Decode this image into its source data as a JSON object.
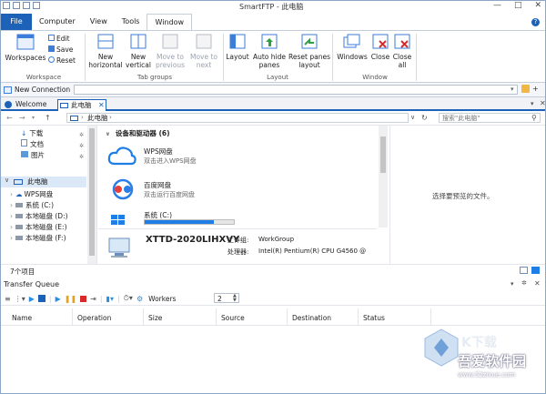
{
  "window": {
    "title": "SmartFTP - 此电脑"
  },
  "ribbon_tabs": [
    "File",
    "Computer",
    "View",
    "Tools",
    "Window"
  ],
  "ribbon": {
    "workspace": {
      "big": "Workspaces",
      "small": [
        "Edit",
        "Save",
        "Reset"
      ],
      "label": "Workspace"
    },
    "tab_groups": {
      "items": [
        "New horizontal",
        "New vertical",
        "Move to previous",
        "Move to next"
      ],
      "label": "Tab groups"
    },
    "layout": {
      "items": [
        "Layout",
        "Auto hide panes",
        "Reset panes layout"
      ],
      "label": "Layout"
    },
    "window": {
      "items": [
        "Windows",
        "Close",
        "Close all"
      ],
      "label": "Window"
    }
  },
  "connection": {
    "label": "New Connection"
  },
  "doc_tabs": [
    "Welcome",
    "此电脑"
  ],
  "explorer": {
    "address": "此电脑",
    "search_placeholder": "搜索\"此电脑\"",
    "tree": [
      "下载",
      "文档",
      "图片",
      "此电脑",
      "WPS网盘",
      "系统 (C:)",
      "本地磁盘 (D:)",
      "本地磁盘 (E:)",
      "本地磁盘 (F:)"
    ],
    "section_header": "设备和驱动器 (6)",
    "items": [
      {
        "name": "WPS网盘",
        "desc": "双击进入WPS网盘"
      },
      {
        "name": "百度网盘",
        "desc": "双击运行百度网盘"
      },
      {
        "name": "系统 (C:)",
        "desc": ""
      }
    ],
    "computer": {
      "name": "XTTD-2020LIHXVY",
      "workgroup_label": "工作组:",
      "workgroup": "WorkGroup",
      "cpu_label": "处理器:",
      "cpu": "Intel(R) Pentium(R) CPU G4560 @"
    },
    "preview_text": "选择要预览的文件。",
    "status": "7个项目",
    "drive_c_used": 0.78
  },
  "transfer_queue": {
    "title": "Transfer Queue",
    "workers_label": "Workers",
    "workers_value": "2",
    "columns": [
      "Name",
      "Operation",
      "Size",
      "Source",
      "Destination",
      "Status"
    ]
  },
  "watermark": {
    "text": "吾爱软件园",
    "url": "www.52zixue.com"
  },
  "colors": {
    "accent": "#1c62b9",
    "tab_active": "#1e7ee6"
  }
}
